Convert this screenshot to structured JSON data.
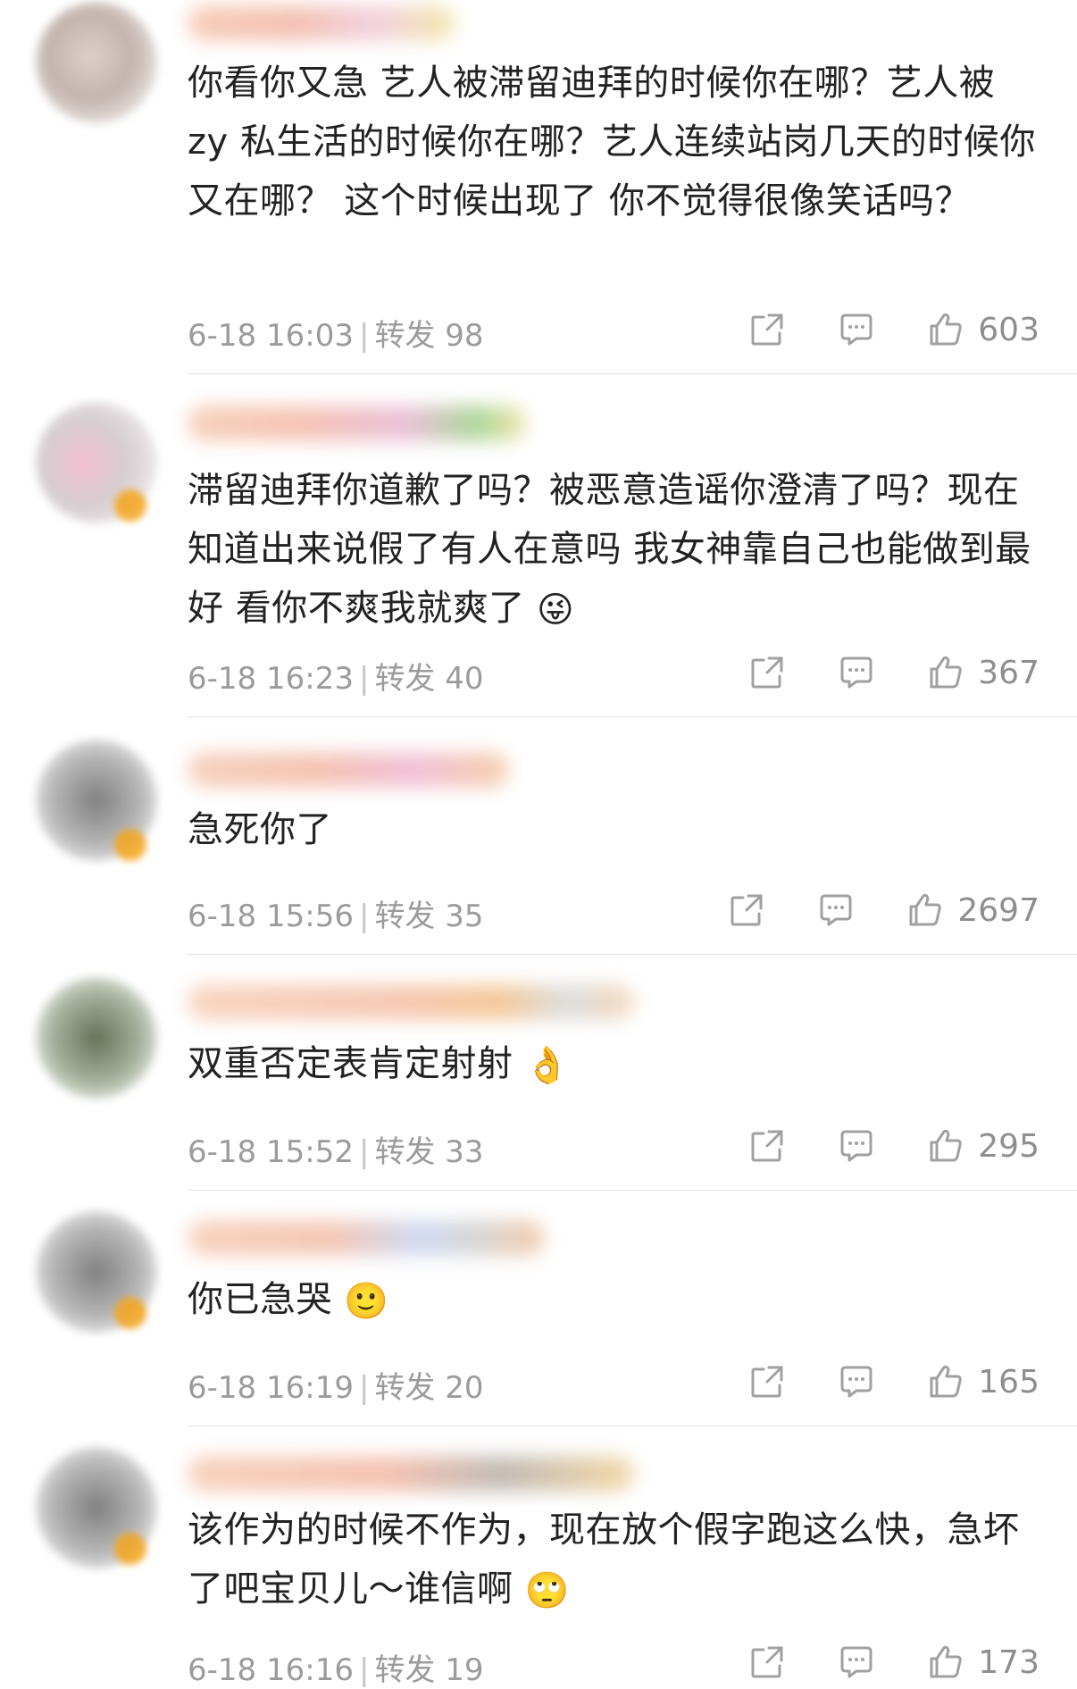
{
  "comments": [
    {
      "text": "你看你又急 艺人被滞留迪拜的时候你在哪？艺人被 zy 私生活的时候你在哪？艺人连续站岗几天的时候你又在哪？ 这个时候出现了 你不觉得很像笑话吗？",
      "emoji": "",
      "time": "6-18 16:03",
      "repost": "转发 98",
      "likes": "603"
    },
    {
      "text": "滞留迪拜你道歉了吗？被恶意造谣你澄清了吗？现在知道出来说假了有人在意吗 我女神靠自己也能做到最好 看你不爽我就爽了",
      "emoji": "😜",
      "time": "6-18 16:23",
      "repost": "转发 40",
      "likes": "367"
    },
    {
      "text": "急死你了",
      "emoji": "",
      "time": "6-18 15:56",
      "repost": "转发 35",
      "likes": "2697"
    },
    {
      "text": "双重否定表肯定射射",
      "emoji": "👌",
      "time": "6-18 15:52",
      "repost": "转发 33",
      "likes": "295"
    },
    {
      "text": "你已急哭",
      "emoji": "🙂",
      "time": "6-18 16:19",
      "repost": "转发 20",
      "likes": "165"
    },
    {
      "text": "该作为的时候不作为，现在放个假字跑这么快，急坏了吧宝贝儿～谁信啊",
      "emoji": "🙄",
      "time": "6-18 16:16",
      "repost": "转发 19",
      "likes": "173"
    }
  ],
  "icons": {
    "share": "share-icon",
    "comment": "comment-icon",
    "like": "thumbs-up-icon"
  },
  "colors": {
    "meta_text": "#9b9b9b",
    "divider": "#e4e4e4"
  }
}
